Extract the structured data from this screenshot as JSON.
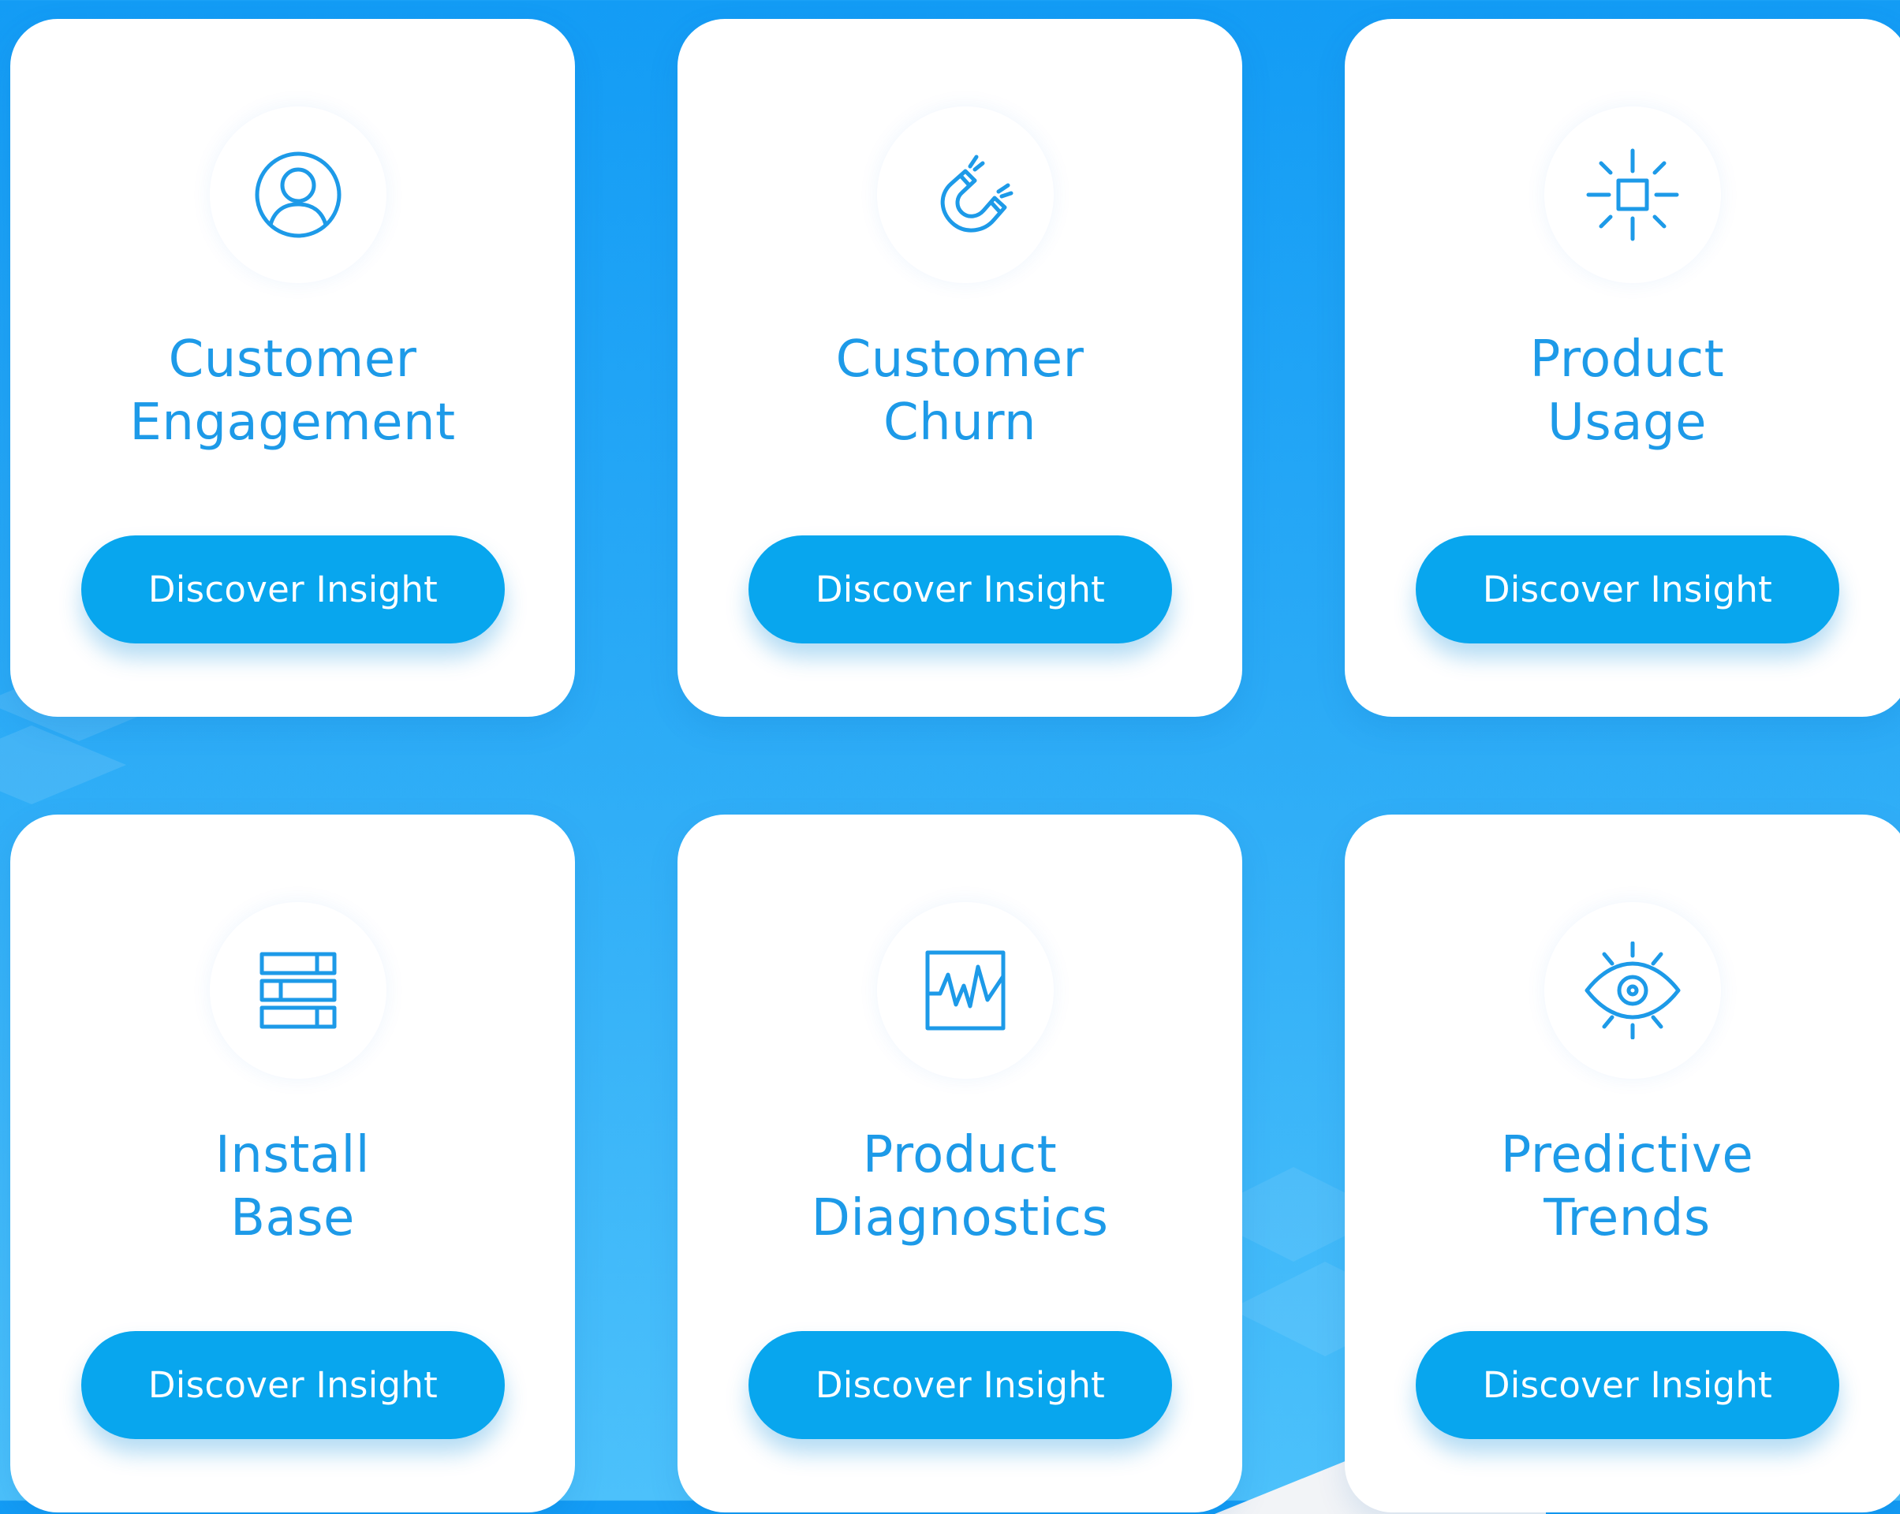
{
  "theme": {
    "accent": "#1d9ae8",
    "button_color": "#08a6ee",
    "background_top": "#139cf5",
    "background_bottom": "#4cc1fb",
    "card_background": "#ffffff"
  },
  "cards": [
    {
      "icon": "user-circle-icon",
      "title_line1": "Customer",
      "title_line2": "Engagement",
      "button_label": "Discover Insight"
    },
    {
      "icon": "magnet-icon",
      "title_line1": "Customer",
      "title_line2": "Churn",
      "button_label": "Discover Insight"
    },
    {
      "icon": "sun-square-icon",
      "title_line1": "Product",
      "title_line2": "Usage",
      "button_label": "Discover Insight"
    },
    {
      "icon": "brick-wall-icon",
      "title_line1": "Install",
      "title_line2": "Base",
      "button_label": "Discover Insight"
    },
    {
      "icon": "waveform-icon",
      "title_line1": "Product",
      "title_line2": "Diagnostics",
      "button_label": "Discover Insight"
    },
    {
      "icon": "eye-icon",
      "title_line1": "Predictive",
      "title_line2": "Trends",
      "button_label": "Discover Insight"
    }
  ]
}
